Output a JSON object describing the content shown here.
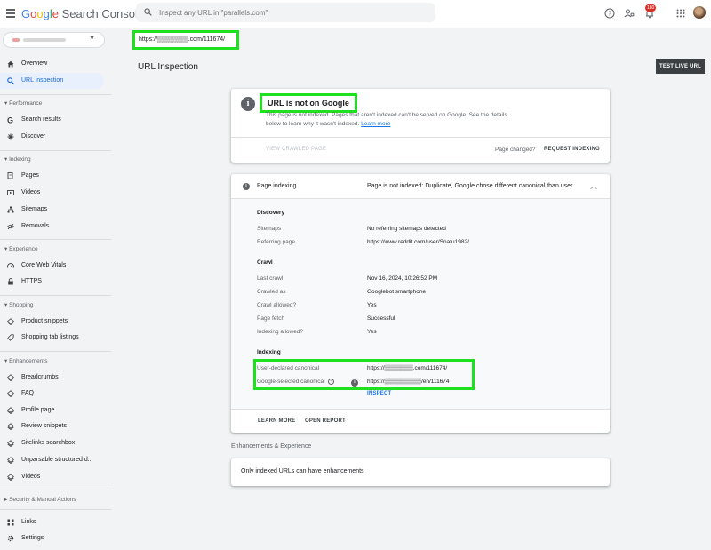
{
  "header": {
    "logo_google": "Google",
    "logo_product": "Search Console",
    "search_placeholder": "Inspect any URL in \"parallels.com\"",
    "notification_count": "180"
  },
  "sidebar": {
    "items": [
      {
        "label": "Overview"
      },
      {
        "label": "URL inspection"
      }
    ],
    "sections": {
      "performance": {
        "title": "Performance",
        "items": [
          "Search results",
          "Discover"
        ]
      },
      "indexing": {
        "title": "Indexing",
        "items": [
          "Pages",
          "Videos",
          "Sitemaps",
          "Removals"
        ]
      },
      "experience": {
        "title": "Experience",
        "items": [
          "Core Web Vitals",
          "HTTPS"
        ]
      },
      "shopping": {
        "title": "Shopping",
        "items": [
          "Product snippets",
          "Shopping tab listings"
        ]
      },
      "enhancements": {
        "title": "Enhancements",
        "items": [
          "Breadcrumbs",
          "FAQ",
          "Profile page",
          "Review snippets",
          "Sitelinks searchbox",
          "Unparsable structured d...",
          "Videos"
        ]
      },
      "security": {
        "title": "Security & Manual Actions"
      }
    },
    "bottom": [
      "Links",
      "Settings"
    ]
  },
  "main": {
    "url": "https://▒▒▒▒▒▒▒.com/111674/",
    "title": "URL Inspection",
    "test_live_button": "TEST LIVE URL",
    "status": {
      "title": "URL is not on Google",
      "desc_text": "This page is not indexed. Pages that aren't indexed can't be served on Google. See the details below to learn why it wasn't indexed.",
      "learn_more_link": "Learn more",
      "view_crawled": "VIEW CRAWLED PAGE",
      "page_changed": "Page changed?",
      "request_indexing": "REQUEST INDEXING"
    },
    "page_indexing": {
      "label": "Page indexing",
      "value": "Page is not indexed: Duplicate, Google chose different canonical than user",
      "discovery_title": "Discovery",
      "sitemaps_label": "Sitemaps",
      "sitemaps_value": "No referring sitemaps detected",
      "referring_label": "Referring page",
      "referring_value": "https://www.reddit.com/user/Snafu1982/",
      "crawl_title": "Crawl",
      "last_crawl_label": "Last crawl",
      "last_crawl_value": "Nov 16, 2024, 10:26:52 PM",
      "crawled_as_label": "Crawled as",
      "crawled_as_value": "Googlebot smartphone",
      "crawl_allowed_label": "Crawl allowed?",
      "crawl_allowed_value": "Yes",
      "page_fetch_label": "Page fetch",
      "page_fetch_value": "Successful",
      "indexing_allowed_label": "Indexing allowed?",
      "indexing_allowed_value": "Yes",
      "indexing_title": "Indexing",
      "user_canonical_label": "User-declared canonical",
      "user_canonical_value": "https://▒▒▒▒▒▒▒.com/111674/",
      "google_canonical_label": "Google-selected canonical",
      "google_canonical_value": "https://▒▒▒▒▒▒▒▒▒/en/111674",
      "inspect": "INSPECT",
      "learn_more": "LEARN MORE",
      "open_report": "OPEN REPORT"
    },
    "enhancements_title": "Enhancements & Experience",
    "enhancements_msg": "Only indexed URLs can have enhancements"
  }
}
